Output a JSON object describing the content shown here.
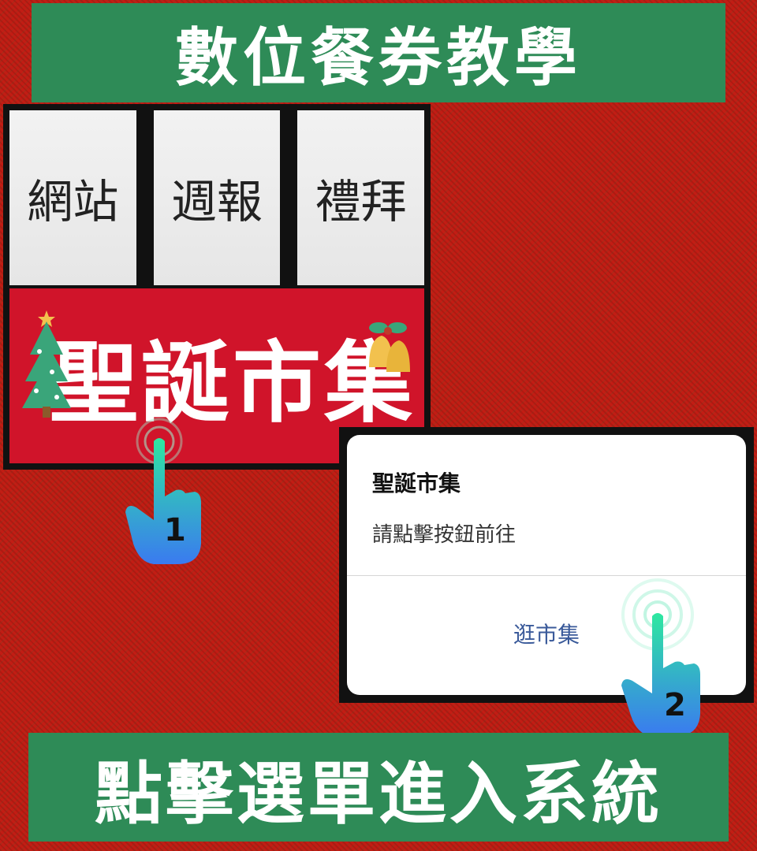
{
  "header": {
    "title": "數位餐券教學"
  },
  "screenshot1": {
    "tabs": [
      {
        "label": "網站"
      },
      {
        "label": "週報"
      },
      {
        "label": "禮拜"
      }
    ],
    "promo": {
      "title": "聖誕市集"
    }
  },
  "dialog": {
    "title": "聖誕市集",
    "message": "請點擊按鈕前往",
    "button_label": "逛市集"
  },
  "steps": {
    "step1": "1",
    "step2": "2"
  },
  "footer": {
    "title": "點擊選單進入系統"
  },
  "colors": {
    "background": "#c21d14",
    "banner": "#2e8b57",
    "promo": "#d0142a",
    "dialog_button": "#3a5a9a"
  },
  "icons": [
    "christmas-tree-icon",
    "bells-icon",
    "tap-hand-icon"
  ]
}
